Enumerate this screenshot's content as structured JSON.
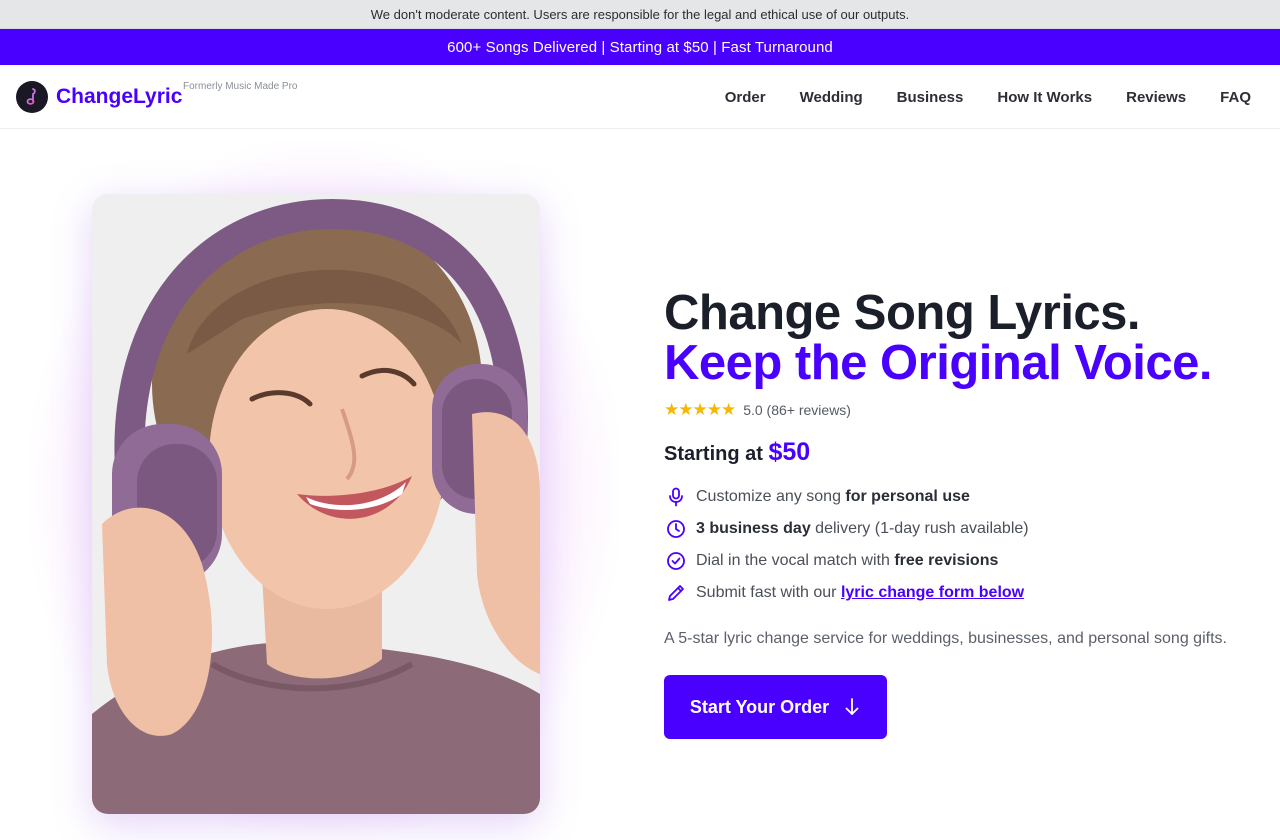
{
  "disclaimer": "We don't moderate content. Users are responsible for the legal and ethical use of our outputs.",
  "promo": "600+ Songs Delivered | Starting at $50 | Fast Turnaround",
  "header": {
    "brand": "ChangeLyric",
    "formerly": "Formerly Music Made Pro",
    "nav": [
      "Order",
      "Wedding",
      "Business",
      "How It Works",
      "Reviews",
      "FAQ"
    ]
  },
  "hero": {
    "title_line1": "Change Song Lyrics.",
    "title_line2": "Keep the Original Voice.",
    "stars": "★★★★★",
    "rating_text": "5.0 (86+ reviews)",
    "price_prefix": "Starting at",
    "price_amount": "$50",
    "features": [
      {
        "icon": "microphone-icon",
        "pre": "Customize any song ",
        "bold": "for personal use",
        "post": ""
      },
      {
        "icon": "clock-icon",
        "pre": "",
        "bold": "3 business day",
        "post": " delivery (1-day rush available)"
      },
      {
        "icon": "check-circle-icon",
        "pre": "Dial in the vocal match with ",
        "bold": "free revisions",
        "post": ""
      },
      {
        "icon": "pencil-icon",
        "pre": "Submit fast with our ",
        "link": "lyric change form below"
      }
    ],
    "description": "A 5-star lyric change service for weddings, businesses, and personal song gifts.",
    "cta_label": "Start Your Order"
  },
  "colors": {
    "accent": "#4a00ff",
    "star": "#f5b800",
    "banner_gray": "#e5e6e8"
  }
}
